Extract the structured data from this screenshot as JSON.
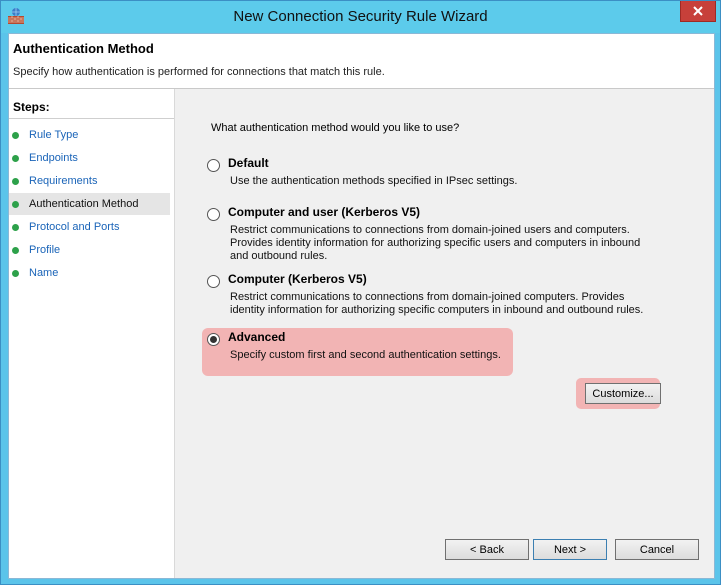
{
  "window": {
    "title": "New Connection Security Rule Wizard"
  },
  "header": {
    "title": "Authentication Method",
    "description": "Specify how authentication is performed for connections that match this rule."
  },
  "steps": {
    "label": "Steps:",
    "items": [
      {
        "label": "Rule Type"
      },
      {
        "label": "Endpoints"
      },
      {
        "label": "Requirements"
      },
      {
        "label": "Authentication Method",
        "current": true
      },
      {
        "label": "Protocol and Ports"
      },
      {
        "label": "Profile"
      },
      {
        "label": "Name"
      }
    ]
  },
  "main": {
    "question": "What authentication method would you like to use?",
    "options": [
      {
        "title": "Default",
        "description": "Use the authentication methods specified in IPsec settings.",
        "selected": false
      },
      {
        "title": "Computer and user (Kerberos V5)",
        "description": "Restrict communications to connections from domain-joined users and computers. Provides identity information for authorizing specific users and computers in inbound and outbound rules.",
        "selected": false
      },
      {
        "title": "Computer (Kerberos V5)",
        "description": "Restrict communications to connections from domain-joined computers.  Provides identity information for authorizing specific computers in inbound and outbound rules.",
        "selected": false
      },
      {
        "title": "Advanced",
        "description": "Specify custom first and second authentication settings.",
        "selected": true
      }
    ],
    "customize_label": "Customize..."
  },
  "footer": {
    "back_label": "< Back",
    "next_label": "Next >",
    "cancel_label": "Cancel"
  },
  "colors": {
    "titlebar": "#5ccbeb",
    "highlight": "#f2b4b4",
    "step_dot": "#2da14a",
    "step_link": "#1a64b8"
  },
  "icons": {
    "app": "firewall-icon",
    "close": "close-icon",
    "step": "green-dot-icon"
  }
}
